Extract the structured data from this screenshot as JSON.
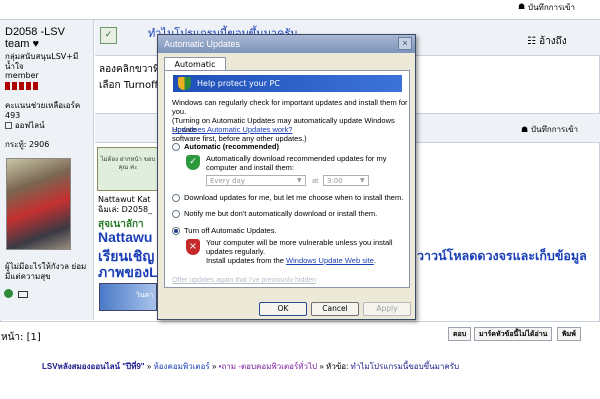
{
  "top": {
    "notes_label": "บันทึกการเข้า"
  },
  "user": {
    "name_line1": "D2058 -LSV",
    "name_line2": "team ♥",
    "group": "กลุ่มสนับสนุนLSV+มีน้ำใจ",
    "rank": "member",
    "helper_label": "คะแนนช่วยเหลือเอร์ค",
    "helper_value": "493",
    "offline": "ออฟไลน์",
    "posts": "กระทู้: 2906",
    "signature": "ผู้ไม่มีอะไรให้กังวล ย่อมมีแต่ความสุข"
  },
  "post": {
    "title": "ทำไมโปรแกรมนี้ขอบขึ้นมาครับ",
    "quote_label": "อ้างถึง",
    "line1": "ลองคลิกขวาที่ M",
    "line2": "เลือก Turnoff",
    "notes_label": "บันทึกการเข้า",
    "sig_name": "Nattawut Kat",
    "sig_nick": "ฉิมเล่: D2058_",
    "sig_green": "สุจเนาลักา",
    "big_line1": "Nattawu",
    "big_line2_left": "เรียนเชิญ",
    "big_line2_right": "วาวน์โหลดดวงจรและเก็บข้อมูล",
    "big_line3": "ภาพของL",
    "banner_text": "ไม่ต้อง ฝากหน้า ขอบ คุณ ค่ะ",
    "logo_text": "วินดา"
  },
  "bottom": {
    "page_label": "หน้า: [1]",
    "btn_reply": "ตอบ",
    "btn_mark": "มาร์คหัวข้อนี้ไม่ได้อ่าน",
    "btn_print": "พิมพ์",
    "bc_home": "LSVหลังสมองออนไลน์ \"ปีที่9\"",
    "bc_sep1": "»",
    "bc_comp": "ห้องคอมพิวเตอร์",
    "bc_sep2": "»",
    "bc_general": "•ถาม -ตอบคอมพิวเตอร์ทั่วไป",
    "bc_sep3": "»",
    "bc_topic_label": "หัวข้อ:",
    "bc_topic": "ทำไมโปรแกรมนี้ขอบขึ้นมาครับ"
  },
  "dialog": {
    "title": "Automatic Updates",
    "close": "×",
    "tab": "Automatic Updates",
    "banner": "Help protect your PC",
    "intro1": "Windows can regularly check for important updates and install them for you.",
    "intro2": "(Turning on Automatic Updates may automatically update Windows Update",
    "intro3": "software first, before any other updates.)",
    "how_link": "How does Automatic Updates work?",
    "opt_automatic": "Automatic (recommended)",
    "auto_desc1": "Automatically download recommended updates for my",
    "auto_desc2": "computer and install them:",
    "day_value": "Every day",
    "at_label": "at",
    "time_value": "3:00",
    "opt_download": "Download updates for me, but let me choose when to install them.",
    "opt_notify": "Notify me but don't automatically download or install them.",
    "opt_off": "Turn off Automatic Updates.",
    "off_desc1": "Your computer will be more vulnerable unless you install",
    "off_desc2": "updates regularly.",
    "off_desc3_pre": "Install updates from the ",
    "off_desc3_link": "Windows Update Web site",
    "off_desc3_post": ".",
    "offer_again": "Offer updates again that I've previously hidden",
    "btn_ok": "OK",
    "btn_cancel": "Cancel",
    "btn_apply": "Apply",
    "colors": {
      "title_bar": "#7d93bb",
      "banner": "#1e4fb8",
      "link": "#1a3fb6"
    }
  }
}
